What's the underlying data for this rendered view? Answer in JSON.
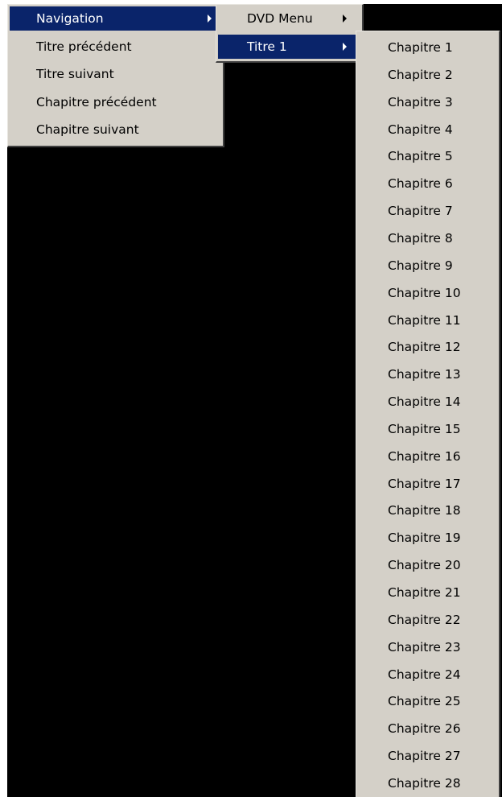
{
  "main_menu": {
    "items": [
      {
        "label": "Navigation",
        "has_submenu": true,
        "selected": true
      },
      {
        "label": "Titre précédent",
        "has_submenu": false,
        "selected": false
      },
      {
        "label": "Titre suivant",
        "has_submenu": false,
        "selected": false
      },
      {
        "label": "Chapitre précédent",
        "has_submenu": false,
        "selected": false
      },
      {
        "label": "Chapitre suivant",
        "has_submenu": false,
        "selected": false
      }
    ]
  },
  "dvd_submenu": {
    "items": [
      {
        "label": "DVD Menu",
        "has_submenu": true,
        "selected": false
      },
      {
        "label": "Titre 1",
        "has_submenu": true,
        "selected": true
      }
    ]
  },
  "chapter_submenu": {
    "items": [
      "Chapitre 1",
      "Chapitre 2",
      "Chapitre 3",
      "Chapitre 4",
      "Chapitre 5",
      "Chapitre 6",
      "Chapitre 7",
      "Chapitre 8",
      "Chapitre 9",
      "Chapitre 10",
      "Chapitre 11",
      "Chapitre 12",
      "Chapitre 13",
      "Chapitre 14",
      "Chapitre 15",
      "Chapitre 16",
      "Chapitre 17",
      "Chapitre 18",
      "Chapitre 19",
      "Chapitre 20",
      "Chapitre 21",
      "Chapitre 22",
      "Chapitre 23",
      "Chapitre 24",
      "Chapitre 25",
      "Chapitre 26",
      "Chapitre 27",
      "Chapitre 28"
    ]
  },
  "colors": {
    "menu_background": "#d4d0c8",
    "selection_background": "#0a246a",
    "selection_text": "#ffffff",
    "video_background": "#000000"
  },
  "icons": {
    "submenu_arrow": "submenu-arrow-icon"
  }
}
